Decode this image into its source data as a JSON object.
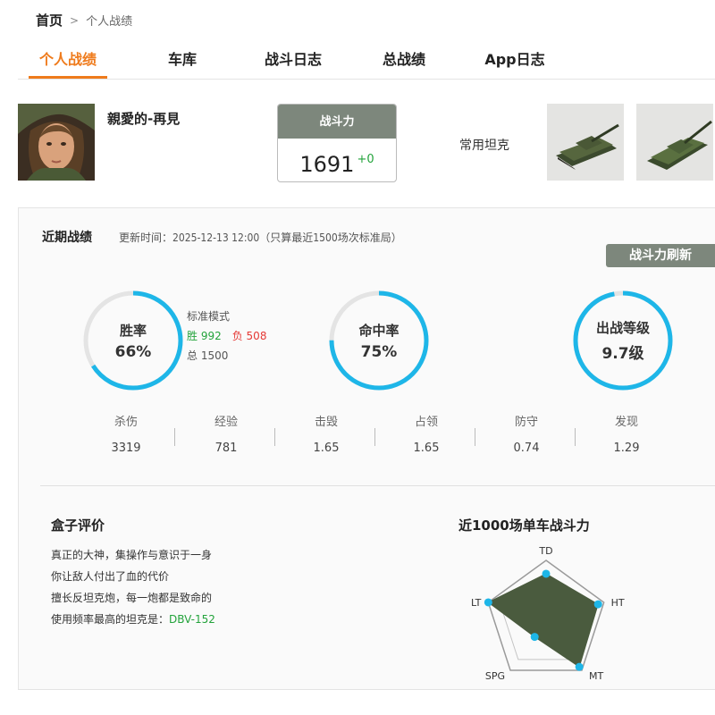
{
  "breadcrumb": {
    "home": "首页",
    "separator": ">",
    "current": "个人战绩"
  },
  "tabs": [
    {
      "label": "个人战绩",
      "active": true
    },
    {
      "label": "车库",
      "active": false
    },
    {
      "label": "战斗日志",
      "active": false
    },
    {
      "label": "总战绩",
      "active": false
    },
    {
      "label": "App日志",
      "active": false
    }
  ],
  "profile": {
    "nickname": "親愛的-再見",
    "avatar_icon": "player-avatar"
  },
  "power": {
    "label": "战斗力",
    "value": "1691",
    "delta": "+0"
  },
  "tanks": {
    "label": "常用坦克",
    "thumbnails": [
      "tank-thumbnail-1",
      "tank-thumbnail-2"
    ]
  },
  "recent": {
    "title": "近期战绩",
    "update_time": "更新时间：2025-12-13 12:00（只算最近1500场次标准局）",
    "refresh_label": "战斗力刷新",
    "rings": {
      "winrate": {
        "label": "胜率",
        "value": "66%",
        "fraction": 0.66
      },
      "hitrate": {
        "label": "命中率",
        "value": "75%",
        "fraction": 0.75
      },
      "tier": {
        "label": "出战等级",
        "value": "9.7级",
        "fraction": 0.97
      }
    },
    "mode": {
      "title": "标准模式",
      "wins": "胜 992",
      "losses": "负 508",
      "total": "总 1500"
    },
    "stats": [
      {
        "label": "杀伤",
        "value": "3319"
      },
      {
        "label": "经验",
        "value": "781"
      },
      {
        "label": "击毁",
        "value": "1.65"
      },
      {
        "label": "占领",
        "value": "1.65"
      },
      {
        "label": "防守",
        "value": "0.74"
      },
      {
        "label": "发现",
        "value": "1.29"
      }
    ]
  },
  "evaluation": {
    "title": "盒子评价",
    "lines": [
      "真正的大神，集操作与意识于一身",
      "你让敌人付出了血的代价",
      "擅长反坦克炮，每一炮都是致命的"
    ],
    "most_used_prefix": "使用频率最高的坦克是：",
    "most_used_tank": "DBV-152"
  },
  "radar": {
    "title": "近1000场单车战斗力",
    "axes": [
      "TD",
      "HT",
      "MT",
      "SPG",
      "LT"
    ],
    "values": [
      0.78,
      0.9,
      0.93,
      0.32,
      1.0
    ]
  },
  "colors": {
    "accent": "#ef7b1c",
    "ring": "#1eb6e8",
    "ring_track": "#e4e4e4",
    "win": "#23a33b",
    "lose": "#e53935",
    "badge": "#7d877c",
    "radar_fill": "#4a5b3e"
  }
}
